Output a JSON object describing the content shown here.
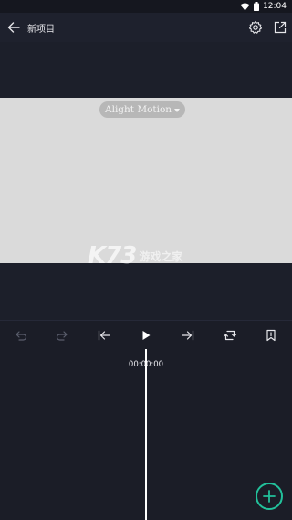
{
  "status_bar": {
    "time": "12:04"
  },
  "app_bar": {
    "title": "新项目"
  },
  "canvas": {
    "background_color": "#dadada",
    "watermark_label": "Alight Motion",
    "site_logo_brand": "K73",
    "site_logo_subtitle": "游戏之家"
  },
  "toolbar": {
    "icons": [
      "undo-icon",
      "redo-icon",
      "skip-to-start-icon",
      "play-icon",
      "skip-to-end-icon",
      "repeat-icon",
      "bookmark-icon"
    ]
  },
  "timeline": {
    "timecode": "00:00:00"
  },
  "colors": {
    "accent": "#22c19b",
    "background": "#1e212d"
  }
}
